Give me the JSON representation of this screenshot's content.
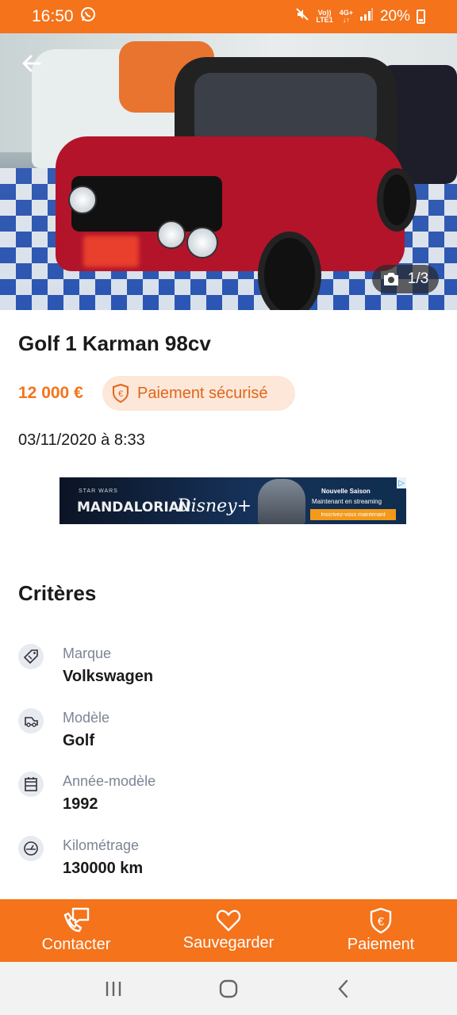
{
  "status_bar": {
    "time": "16:50",
    "network_top": "Vo))",
    "network_bottom": "LTE1",
    "signal_top": "4G+",
    "battery": "20%"
  },
  "listing": {
    "photo_counter": "1/3",
    "title": "Golf 1 Karman 98cv",
    "price": "12 000 €",
    "secure_payment_label": "Paiement sécurisé",
    "date": "03/11/2020 à 8:33"
  },
  "ad": {
    "star_wars": "STAR WARS",
    "mandalorian": "MANDALORIAN",
    "disney": "Disney+",
    "line1": "Nouvelle Saison",
    "line2": "Maintenant en streaming",
    "cta": "Inscrivez-vous maintenant"
  },
  "criteria": {
    "section_title": "Critères",
    "items": [
      {
        "label": "Marque",
        "value": "Volkswagen",
        "icon": "tag-icon"
      },
      {
        "label": "Modèle",
        "value": "Golf",
        "icon": "car-icon"
      },
      {
        "label": "Année-modèle",
        "value": "1992",
        "icon": "calendar-icon"
      },
      {
        "label": "Kilométrage",
        "value": "130000 km",
        "icon": "gauge-icon"
      }
    ]
  },
  "bottom_bar": {
    "contact": "Contacter",
    "save": "Sauvegarder",
    "payment": "Paiement"
  },
  "colors": {
    "brand": "#f4731b",
    "badge_bg": "#fde7d8",
    "label_grey": "#7b8594"
  }
}
